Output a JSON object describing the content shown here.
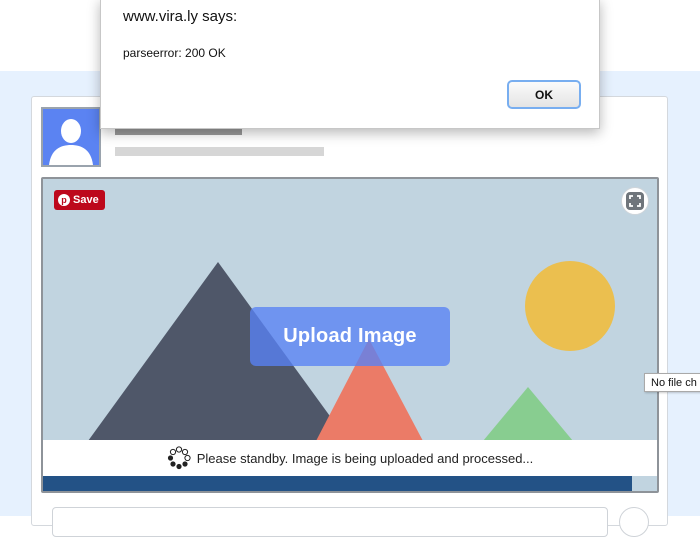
{
  "dialog": {
    "title": "www.vira.ly says:",
    "message": "parseerror: 200 OK",
    "ok_label": "OK"
  },
  "post": {
    "pin_save_label": "Save",
    "pin_logo_glyph": "p",
    "upload_label": "Upload Image",
    "status_text": "Please standby. Image is being uploaded and processed...",
    "progress_fraction": 0.96
  },
  "tooltip": {
    "text": "No file ch"
  },
  "colors": {
    "page_background": "#e6f1fe",
    "pinterest_red": "#bd081c",
    "upload_button": "#5882f5",
    "progress_bar": "#235286",
    "avatar_blue": "#5b83f2"
  },
  "icons": {
    "avatar": "user-silhouette-icon",
    "expand": "expand-icon",
    "spinner": "loading-spinner-icon",
    "pinterest": "pinterest-logo-icon"
  }
}
